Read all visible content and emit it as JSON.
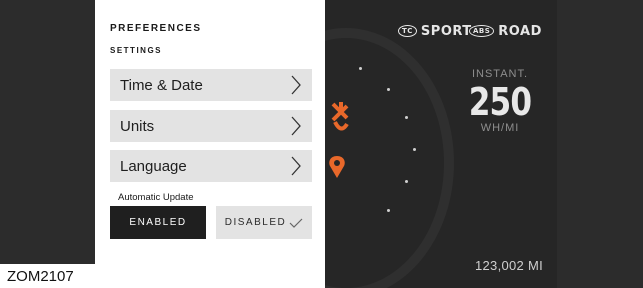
{
  "reference_code": "ZOM2107",
  "preferences": {
    "title": "PREFERENCES",
    "section": "SETTINGS",
    "items": [
      {
        "label": "Time & Date"
      },
      {
        "label": "Units"
      },
      {
        "label": "Language"
      }
    ],
    "auto_update": {
      "label": "Automatic Update",
      "enabled_label": "ENABLED",
      "disabled_label": "DISABLED",
      "selected": "DISABLED"
    }
  },
  "dashboard": {
    "modes": {
      "tc_badge": "TC",
      "sport": "SPORT",
      "abs_badge": "ABS",
      "road": "ROAD"
    },
    "instant": {
      "label": "INSTANT.",
      "value": "250",
      "unit": "WH/MI"
    },
    "odometer": "123,002 MI"
  },
  "colors": {
    "panel_bg": "#ffffff",
    "menu_item_bg": "#e3e3e3",
    "dash_bg": "#262626",
    "accent": "#e8682a"
  },
  "icons": [
    "chevron-right-icon",
    "checkmark-icon",
    "traction-control-icon",
    "abs-icon",
    "charge-arrow-icon",
    "location-pin-icon"
  ]
}
